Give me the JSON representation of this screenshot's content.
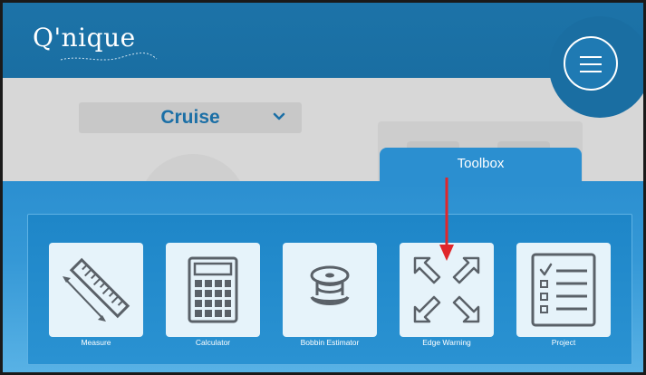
{
  "header": {
    "logo_text": "Q'nique",
    "menu_icon": "hamburger-icon"
  },
  "mode": {
    "selected": "Cruise",
    "icon": "chevron-down-icon"
  },
  "toolbox": {
    "title": "Toolbox",
    "tools": [
      {
        "label": "Measure",
        "icon": "ruler-icon"
      },
      {
        "label": "Calculator",
        "icon": "calculator-icon"
      },
      {
        "label": "Bobbin Estimator",
        "icon": "bobbin-icon"
      },
      {
        "label": "Edge Warning",
        "icon": "expand-arrows-icon"
      },
      {
        "label": "Project",
        "icon": "checklist-icon"
      }
    ]
  },
  "colors": {
    "header_blue": "#1a6ea2",
    "toolbox_blue": "#2b8fd0",
    "tile_bg": "#e6f3fa",
    "icon_gray": "#5a6168",
    "annotation_red": "#e0262b"
  }
}
